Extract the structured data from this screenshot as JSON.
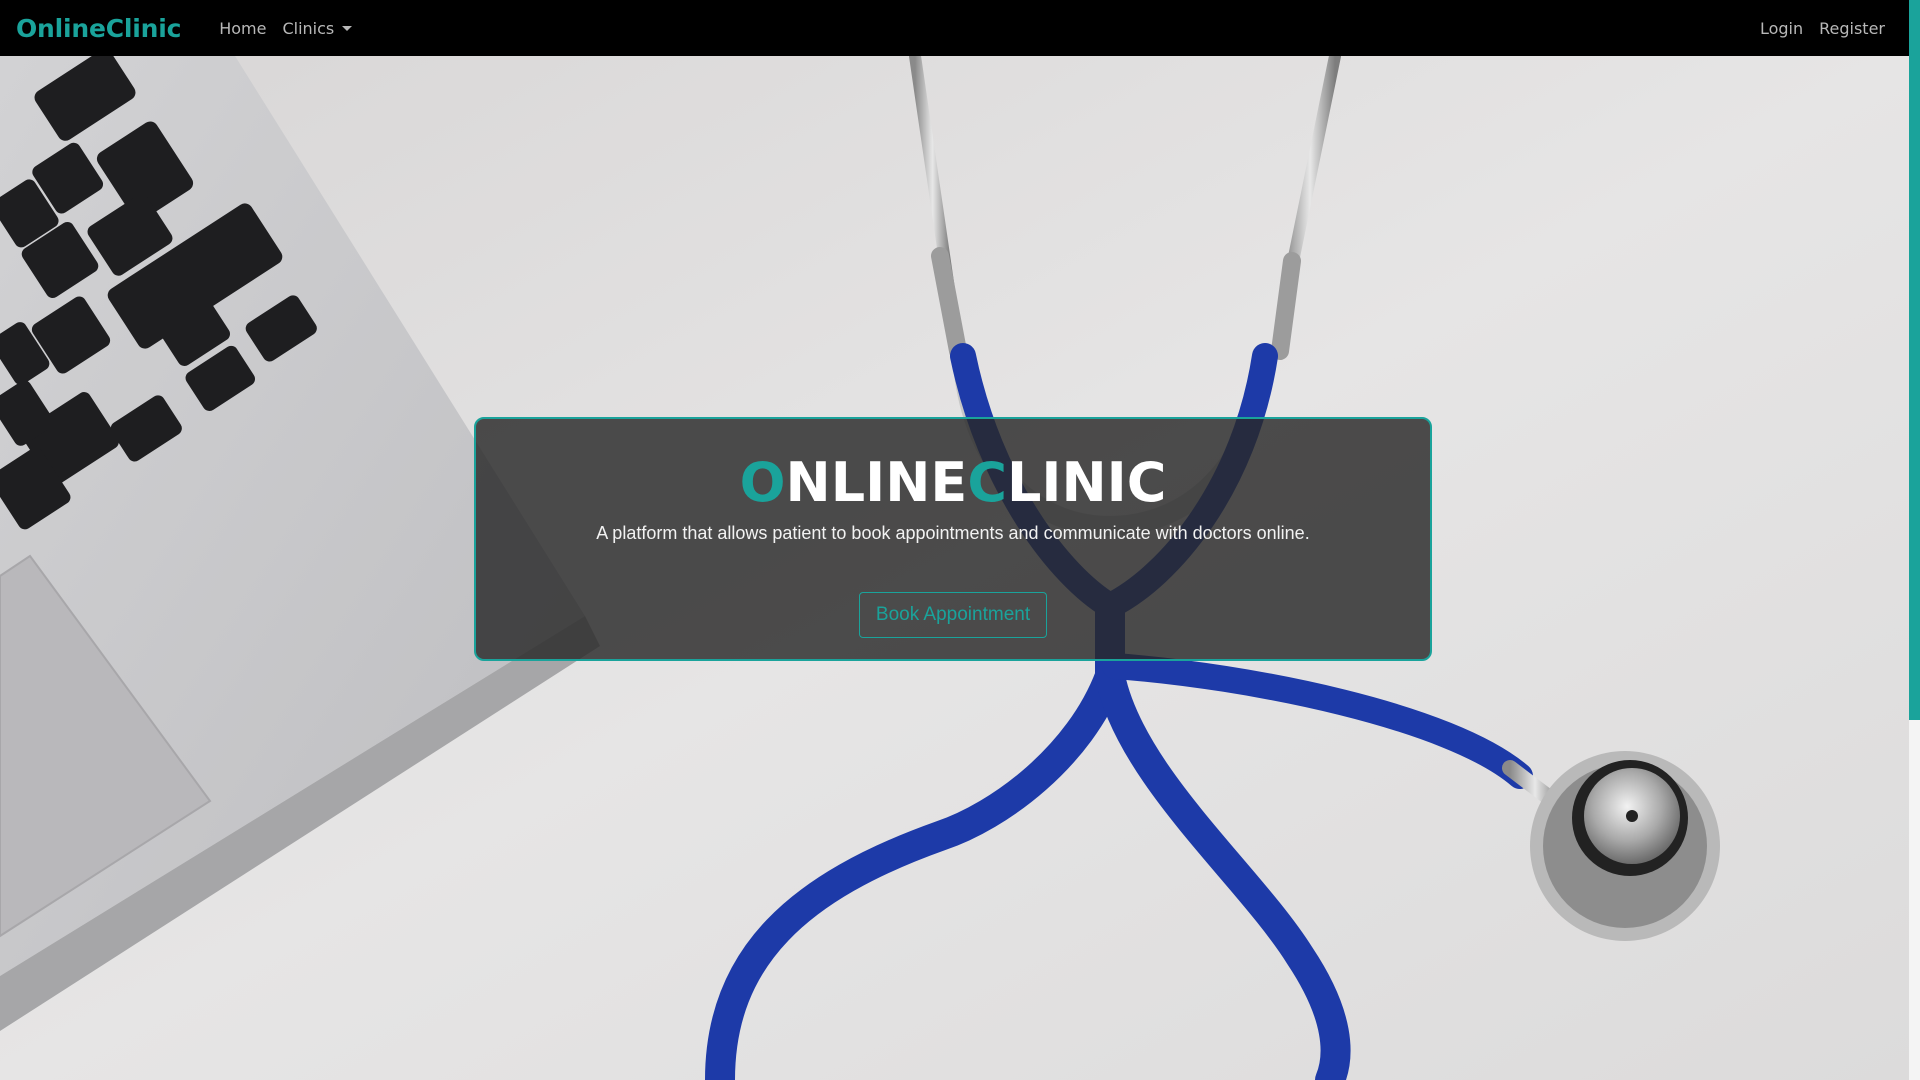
{
  "navbar": {
    "brand": "OnlineClinic",
    "links": {
      "home": "Home",
      "clinics": "Clinics"
    },
    "auth": {
      "login": "Login",
      "register": "Register"
    }
  },
  "hero": {
    "title_part1_initial": "O",
    "title_part1_rest": "NLINE",
    "title_part2_initial": "C",
    "title_part2_rest": "LINIC",
    "subtitle": "A platform that allows patient to book appointments and communicate with doctors online.",
    "cta_label": "Book Appointment"
  },
  "colors": {
    "accent": "#1aa39b",
    "navbar_bg": "#000000",
    "card_bg": "rgba(40,40,40,0.82)",
    "stethoscope_tube": "#1d3aa8"
  },
  "icons": {
    "dropdown": "caret-down-icon"
  }
}
